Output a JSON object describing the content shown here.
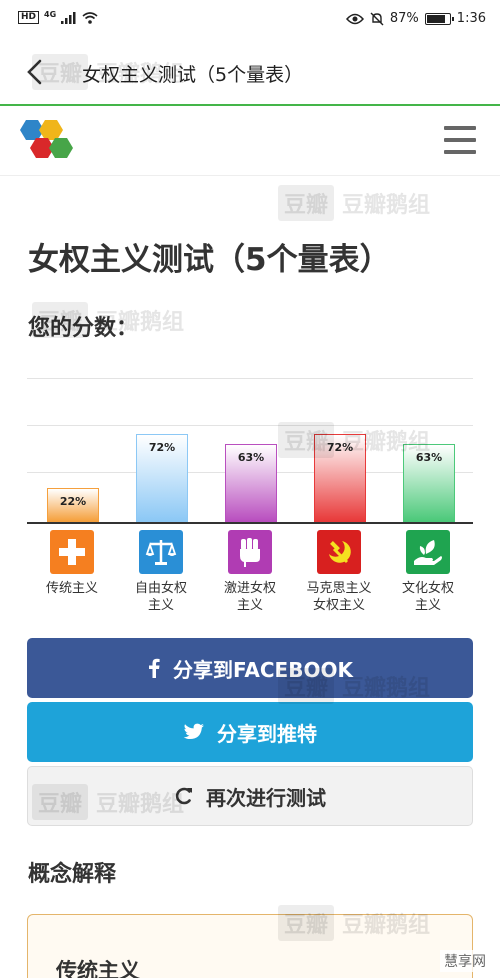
{
  "status_bar": {
    "hd": "HD",
    "network": "4G",
    "battery_percent": "87%",
    "battery_level": 0.87,
    "time": "1:36",
    "icons": [
      "signal-icon",
      "wifi-icon",
      "eye-icon",
      "mute-icon",
      "battery-icon"
    ]
  },
  "nav": {
    "title": "女权主义测试（5个量表）",
    "back_icon": "chevron-left-icon"
  },
  "header": {
    "logo_icon": "hexagon-logo-icon",
    "menu_icon": "hamburger-menu-icon"
  },
  "main": {
    "title": "女权主义测试（5个量表）",
    "score_label": "您的分数："
  },
  "chart_data": {
    "type": "bar",
    "categories": [
      "传统主义",
      "自由女权主义",
      "激进女权主义",
      "马克思主义女权主义",
      "文化女权主义"
    ],
    "category_labels": [
      "传统主义",
      "自由女权\n主义",
      "激进女权\n主义",
      "马克思主义\n女权主义",
      "文化女权\n主义"
    ],
    "values": [
      22,
      72,
      63,
      72,
      63
    ],
    "value_labels": [
      "22%",
      "72%",
      "63%",
      "72%",
      "63%"
    ],
    "ylim": [
      0,
      100
    ],
    "grid": true,
    "colors": [
      "#f5a03d",
      "#8cc8f5",
      "#b94fbf",
      "#e83a3a",
      "#4cc97a"
    ],
    "icons": [
      "cross-icon",
      "scales-icon",
      "fist-icon",
      "hammer-sickle-icon",
      "hand-leaf-icon"
    ],
    "icon_colors": [
      "#f57f20",
      "#2a8fd6",
      "#b03cb3",
      "#d8201f",
      "#1fa450"
    ]
  },
  "share": {
    "facebook_label": "分享到FACEBOOK",
    "facebook_icon": "facebook-icon",
    "twitter_label": "分享到推特",
    "twitter_icon": "twitter-icon",
    "retake_label": "再次进行测试",
    "retake_icon": "refresh-icon",
    "facebook_color": "#3b5897",
    "twitter_color": "#1ea3d9"
  },
  "concepts": {
    "section_title": "概念解释",
    "first_title": "传统主义"
  },
  "watermarks": {
    "douban": "豆瓣",
    "group": "豆瓣鹅组",
    "corner": "慧享网"
  }
}
